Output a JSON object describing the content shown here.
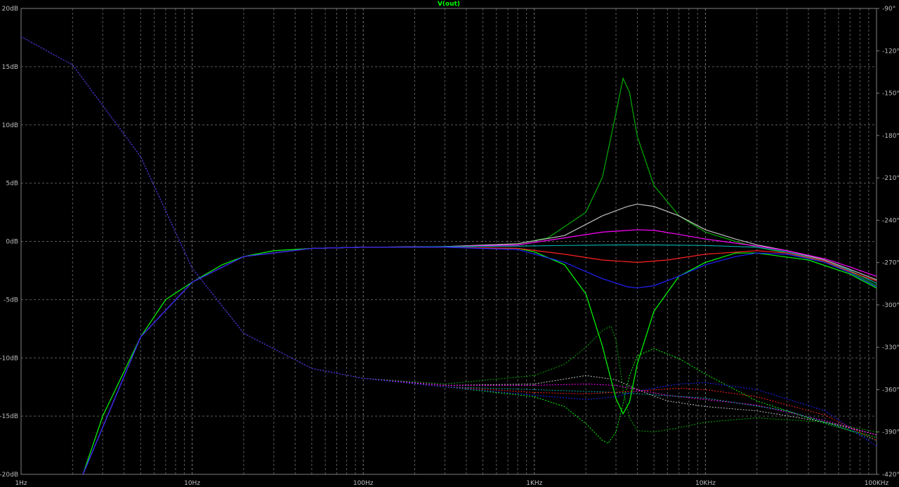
{
  "chart_data": {
    "type": "line",
    "title": "V(out)",
    "x_scale": "log",
    "x_ticks": [
      "1Hz",
      "10Hz",
      "100Hz",
      "1KHz",
      "10KHz",
      "100KHz"
    ],
    "y_left_ticks": [
      "20dB",
      "15dB",
      "10dB",
      "5dB",
      "0dB",
      "-5dB",
      "-10dB",
      "-15dB",
      "-20dB"
    ],
    "y_right_ticks": [
      "-90°",
      "-120°",
      "-150°",
      "-180°",
      "-210°",
      "-240°",
      "-270°",
      "-300°",
      "-330°",
      "-360°",
      "-390°",
      "-420°"
    ],
    "xlim_hz": [
      1,
      100000
    ],
    "ylim_db": [
      -20,
      20
    ],
    "ylim_phase_deg": [
      -420,
      -90
    ],
    "grid": true,
    "legend": "none",
    "magnitude_series": [
      {
        "color": "#00ff00",
        "values": [
          [
            2.3,
            -20.0
          ],
          [
            3,
            -15.0
          ],
          [
            5,
            -8.2
          ],
          [
            7,
            -5.0
          ],
          [
            10,
            -3.5
          ],
          [
            15,
            -2.0
          ],
          [
            20,
            -1.3
          ],
          [
            30,
            -0.8
          ],
          [
            50,
            -0.6
          ],
          [
            100,
            -0.5
          ],
          [
            300,
            -0.5
          ],
          [
            800,
            -0.6
          ],
          [
            1000,
            -0.9
          ],
          [
            1500,
            -2.0
          ],
          [
            2000,
            -4.5
          ],
          [
            2500,
            -9.0
          ],
          [
            3000,
            -13.5
          ],
          [
            3300,
            -14.8
          ],
          [
            3600,
            -13.8
          ],
          [
            4000,
            -10.5
          ],
          [
            5000,
            -6.0
          ],
          [
            7000,
            -3.0
          ],
          [
            10000,
            -1.8
          ],
          [
            15000,
            -1.0
          ],
          [
            20000,
            -1.0
          ],
          [
            40000,
            -1.6
          ],
          [
            70000,
            -2.8
          ],
          [
            100000,
            -4.0
          ]
        ]
      },
      {
        "color": "#00aa00",
        "values": [
          [
            2.3,
            -20.0
          ],
          [
            5,
            -8.2
          ],
          [
            10,
            -3.5
          ],
          [
            20,
            -1.3
          ],
          [
            50,
            -0.6
          ],
          [
            100,
            -0.5
          ],
          [
            300,
            -0.45
          ],
          [
            800,
            -0.2
          ],
          [
            1200,
            0.3
          ],
          [
            2000,
            2.5
          ],
          [
            2500,
            5.5
          ],
          [
            3000,
            11.0
          ],
          [
            3300,
            14.0
          ],
          [
            3600,
            12.8
          ],
          [
            4000,
            9.0
          ],
          [
            5000,
            4.8
          ],
          [
            7000,
            2.2
          ],
          [
            10000,
            0.8
          ],
          [
            15000,
            0.0
          ],
          [
            20000,
            -0.5
          ],
          [
            30000,
            -1.0
          ],
          [
            50000,
            -1.8
          ],
          [
            70000,
            -2.6
          ],
          [
            100000,
            -3.8
          ]
        ]
      },
      {
        "color": "#bfbfbf",
        "values": [
          [
            2.3,
            -20.0
          ],
          [
            5,
            -8.2
          ],
          [
            10,
            -3.5
          ],
          [
            20,
            -1.3
          ],
          [
            50,
            -0.6
          ],
          [
            100,
            -0.5
          ],
          [
            300,
            -0.45
          ],
          [
            800,
            -0.2
          ],
          [
            1500,
            0.5
          ],
          [
            2500,
            2.2
          ],
          [
            3500,
            3.0
          ],
          [
            4000,
            3.2
          ],
          [
            5000,
            3.0
          ],
          [
            7000,
            2.2
          ],
          [
            10000,
            1.0
          ],
          [
            15000,
            0.2
          ],
          [
            20000,
            -0.3
          ],
          [
            30000,
            -0.8
          ],
          [
            50000,
            -1.6
          ],
          [
            70000,
            -2.4
          ],
          [
            100000,
            -3.3
          ]
        ]
      },
      {
        "color": "#ff00ff",
        "values": [
          [
            2.3,
            -20.0
          ],
          [
            5,
            -8.2
          ],
          [
            10,
            -3.5
          ],
          [
            20,
            -1.3
          ],
          [
            50,
            -0.6
          ],
          [
            100,
            -0.5
          ],
          [
            300,
            -0.45
          ],
          [
            800,
            -0.3
          ],
          [
            1500,
            0.3
          ],
          [
            2500,
            0.8
          ],
          [
            4000,
            1.0
          ],
          [
            5000,
            0.95
          ],
          [
            7000,
            0.6
          ],
          [
            10000,
            0.2
          ],
          [
            20000,
            -0.4
          ],
          [
            30000,
            -0.8
          ],
          [
            50000,
            -1.5
          ],
          [
            70000,
            -2.2
          ],
          [
            100000,
            -3.0
          ]
        ]
      },
      {
        "color": "#00aaaa",
        "values": [
          [
            2.3,
            -20.0
          ],
          [
            5,
            -8.2
          ],
          [
            10,
            -3.5
          ],
          [
            20,
            -1.3
          ],
          [
            50,
            -0.6
          ],
          [
            100,
            -0.5
          ],
          [
            300,
            -0.45
          ],
          [
            800,
            -0.4
          ],
          [
            1500,
            -0.35
          ],
          [
            3000,
            -0.3
          ],
          [
            5000,
            -0.3
          ],
          [
            10000,
            -0.35
          ],
          [
            20000,
            -0.5
          ],
          [
            30000,
            -0.9
          ],
          [
            50000,
            -1.7
          ],
          [
            70000,
            -2.5
          ],
          [
            100000,
            -3.6
          ]
        ]
      },
      {
        "color": "#ff2020",
        "values": [
          [
            2.3,
            -20.0
          ],
          [
            5,
            -8.2
          ],
          [
            10,
            -3.5
          ],
          [
            20,
            -1.3
          ],
          [
            50,
            -0.6
          ],
          [
            100,
            -0.5
          ],
          [
            300,
            -0.5
          ],
          [
            800,
            -0.6
          ],
          [
            1500,
            -1.1
          ],
          [
            2500,
            -1.6
          ],
          [
            4000,
            -1.8
          ],
          [
            6000,
            -1.6
          ],
          [
            10000,
            -1.1
          ],
          [
            20000,
            -0.8
          ],
          [
            30000,
            -1.0
          ],
          [
            50000,
            -1.7
          ],
          [
            70000,
            -2.6
          ],
          [
            100000,
            -3.4
          ]
        ]
      },
      {
        "color": "#2020ff",
        "values": [
          [
            2.3,
            -20.0
          ],
          [
            5,
            -8.2
          ],
          [
            10,
            -3.5
          ],
          [
            20,
            -1.3
          ],
          [
            50,
            -0.6
          ],
          [
            100,
            -0.5
          ],
          [
            300,
            -0.5
          ],
          [
            800,
            -0.7
          ],
          [
            1500,
            -1.8
          ],
          [
            2500,
            -3.2
          ],
          [
            3500,
            -3.9
          ],
          [
            4000,
            -4.0
          ],
          [
            5000,
            -3.8
          ],
          [
            7000,
            -3.0
          ],
          [
            10000,
            -2.0
          ],
          [
            15000,
            -1.3
          ],
          [
            20000,
            -1.0
          ],
          [
            30000,
            -1.1
          ],
          [
            50000,
            -1.8
          ],
          [
            70000,
            -2.7
          ],
          [
            100000,
            -3.9
          ]
        ]
      }
    ],
    "phase_series": [
      {
        "color": "#00ff00",
        "values": [
          [
            1,
            -110
          ],
          [
            2,
            -130
          ],
          [
            5,
            -195
          ],
          [
            10,
            -274
          ],
          [
            20,
            -320
          ],
          [
            50,
            -345
          ],
          [
            100,
            -352
          ],
          [
            300,
            -358
          ],
          [
            1000,
            -365
          ],
          [
            1500,
            -372
          ],
          [
            2000,
            -384
          ],
          [
            2500,
            -396
          ],
          [
            2700,
            -398
          ],
          [
            3000,
            -390
          ],
          [
            3300,
            -370
          ],
          [
            3600,
            -350
          ],
          [
            4000,
            -336
          ],
          [
            5000,
            -331
          ],
          [
            7000,
            -338
          ],
          [
            10000,
            -349
          ],
          [
            20000,
            -368
          ],
          [
            50000,
            -384
          ],
          [
            100000,
            -394
          ]
        ]
      },
      {
        "color": "#00aa00",
        "values": [
          [
            1,
            -110
          ],
          [
            2,
            -130
          ],
          [
            5,
            -195
          ],
          [
            10,
            -274
          ],
          [
            20,
            -320
          ],
          [
            50,
            -345
          ],
          [
            100,
            -352
          ],
          [
            300,
            -356
          ],
          [
            1000,
            -350
          ],
          [
            1500,
            -342
          ],
          [
            2000,
            -330
          ],
          [
            2500,
            -318
          ],
          [
            2800,
            -315
          ],
          [
            3000,
            -325
          ],
          [
            3300,
            -360
          ],
          [
            3600,
            -380
          ],
          [
            4000,
            -389
          ],
          [
            5000,
            -390
          ],
          [
            7000,
            -387
          ],
          [
            10000,
            -383
          ],
          [
            20000,
            -380
          ],
          [
            50000,
            -383
          ],
          [
            100000,
            -390
          ]
        ]
      },
      {
        "color": "#bfbfbf",
        "values": [
          [
            1,
            -110
          ],
          [
            2,
            -130
          ],
          [
            5,
            -195
          ],
          [
            10,
            -274
          ],
          [
            20,
            -320
          ],
          [
            50,
            -345
          ],
          [
            100,
            -352
          ],
          [
            300,
            -357
          ],
          [
            1000,
            -356
          ],
          [
            2000,
            -350
          ],
          [
            3000,
            -353
          ],
          [
            4000,
            -360
          ],
          [
            6000,
            -368
          ],
          [
            10000,
            -372
          ],
          [
            20000,
            -375
          ],
          [
            50000,
            -383
          ],
          [
            100000,
            -392
          ]
        ]
      },
      {
        "color": "#ff00ff",
        "values": [
          [
            1,
            -110
          ],
          [
            2,
            -130
          ],
          [
            5,
            -195
          ],
          [
            10,
            -274
          ],
          [
            20,
            -320
          ],
          [
            50,
            -345
          ],
          [
            100,
            -352
          ],
          [
            300,
            -357
          ],
          [
            1000,
            -357
          ],
          [
            2000,
            -356
          ],
          [
            3000,
            -357
          ],
          [
            4000,
            -360
          ],
          [
            6000,
            -364
          ],
          [
            10000,
            -367
          ],
          [
            20000,
            -371
          ],
          [
            50000,
            -382
          ],
          [
            100000,
            -392
          ]
        ]
      },
      {
        "color": "#00aaaa",
        "values": [
          [
            1,
            -110
          ],
          [
            2,
            -130
          ],
          [
            5,
            -195
          ],
          [
            10,
            -274
          ],
          [
            20,
            -320
          ],
          [
            50,
            -345
          ],
          [
            100,
            -352
          ],
          [
            300,
            -358
          ],
          [
            1000,
            -360
          ],
          [
            3000,
            -362
          ],
          [
            10000,
            -366
          ],
          [
            30000,
            -375
          ],
          [
            60000,
            -386
          ],
          [
            100000,
            -396
          ]
        ]
      },
      {
        "color": "#ff2020",
        "values": [
          [
            1,
            -110
          ],
          [
            2,
            -130
          ],
          [
            5,
            -195
          ],
          [
            10,
            -274
          ],
          [
            20,
            -320
          ],
          [
            50,
            -345
          ],
          [
            100,
            -352
          ],
          [
            300,
            -358
          ],
          [
            1000,
            -362
          ],
          [
            2000,
            -363
          ],
          [
            4000,
            -361
          ],
          [
            7000,
            -359
          ],
          [
            10000,
            -360
          ],
          [
            20000,
            -365
          ],
          [
            50000,
            -378
          ],
          [
            100000,
            -396
          ]
        ]
      },
      {
        "color": "#2020ff",
        "values": [
          [
            1,
            -110
          ],
          [
            2,
            -130
          ],
          [
            5,
            -195
          ],
          [
            10,
            -274
          ],
          [
            20,
            -320
          ],
          [
            50,
            -345
          ],
          [
            100,
            -352
          ],
          [
            300,
            -358
          ],
          [
            1000,
            -364
          ],
          [
            2000,
            -367
          ],
          [
            3000,
            -365
          ],
          [
            4000,
            -361
          ],
          [
            7000,
            -356
          ],
          [
            10000,
            -355
          ],
          [
            20000,
            -360
          ],
          [
            50000,
            -375
          ],
          [
            100000,
            -400
          ]
        ]
      }
    ]
  }
}
